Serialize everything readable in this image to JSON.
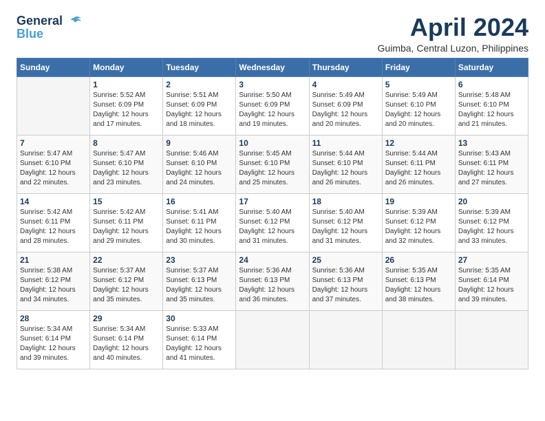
{
  "header": {
    "logo_line1": "General",
    "logo_line2": "Blue",
    "title": "April 2024",
    "subtitle": "Guimba, Central Luzon, Philippines"
  },
  "calendar": {
    "days_of_week": [
      "Sunday",
      "Monday",
      "Tuesday",
      "Wednesday",
      "Thursday",
      "Friday",
      "Saturday"
    ],
    "weeks": [
      [
        {
          "day": "",
          "info": ""
        },
        {
          "day": "1",
          "info": "Sunrise: 5:52 AM\nSunset: 6:09 PM\nDaylight: 12 hours\nand 17 minutes."
        },
        {
          "day": "2",
          "info": "Sunrise: 5:51 AM\nSunset: 6:09 PM\nDaylight: 12 hours\nand 18 minutes."
        },
        {
          "day": "3",
          "info": "Sunrise: 5:50 AM\nSunset: 6:09 PM\nDaylight: 12 hours\nand 19 minutes."
        },
        {
          "day": "4",
          "info": "Sunrise: 5:49 AM\nSunset: 6:09 PM\nDaylight: 12 hours\nand 20 minutes."
        },
        {
          "day": "5",
          "info": "Sunrise: 5:49 AM\nSunset: 6:10 PM\nDaylight: 12 hours\nand 20 minutes."
        },
        {
          "day": "6",
          "info": "Sunrise: 5:48 AM\nSunset: 6:10 PM\nDaylight: 12 hours\nand 21 minutes."
        }
      ],
      [
        {
          "day": "7",
          "info": "Sunrise: 5:47 AM\nSunset: 6:10 PM\nDaylight: 12 hours\nand 22 minutes."
        },
        {
          "day": "8",
          "info": "Sunrise: 5:47 AM\nSunset: 6:10 PM\nDaylight: 12 hours\nand 23 minutes."
        },
        {
          "day": "9",
          "info": "Sunrise: 5:46 AM\nSunset: 6:10 PM\nDaylight: 12 hours\nand 24 minutes."
        },
        {
          "day": "10",
          "info": "Sunrise: 5:45 AM\nSunset: 6:10 PM\nDaylight: 12 hours\nand 25 minutes."
        },
        {
          "day": "11",
          "info": "Sunrise: 5:44 AM\nSunset: 6:10 PM\nDaylight: 12 hours\nand 26 minutes."
        },
        {
          "day": "12",
          "info": "Sunrise: 5:44 AM\nSunset: 6:11 PM\nDaylight: 12 hours\nand 26 minutes."
        },
        {
          "day": "13",
          "info": "Sunrise: 5:43 AM\nSunset: 6:11 PM\nDaylight: 12 hours\nand 27 minutes."
        }
      ],
      [
        {
          "day": "14",
          "info": "Sunrise: 5:42 AM\nSunset: 6:11 PM\nDaylight: 12 hours\nand 28 minutes."
        },
        {
          "day": "15",
          "info": "Sunrise: 5:42 AM\nSunset: 6:11 PM\nDaylight: 12 hours\nand 29 minutes."
        },
        {
          "day": "16",
          "info": "Sunrise: 5:41 AM\nSunset: 6:11 PM\nDaylight: 12 hours\nand 30 minutes."
        },
        {
          "day": "17",
          "info": "Sunrise: 5:40 AM\nSunset: 6:12 PM\nDaylight: 12 hours\nand 31 minutes."
        },
        {
          "day": "18",
          "info": "Sunrise: 5:40 AM\nSunset: 6:12 PM\nDaylight: 12 hours\nand 31 minutes."
        },
        {
          "day": "19",
          "info": "Sunrise: 5:39 AM\nSunset: 6:12 PM\nDaylight: 12 hours\nand 32 minutes."
        },
        {
          "day": "20",
          "info": "Sunrise: 5:39 AM\nSunset: 6:12 PM\nDaylight: 12 hours\nand 33 minutes."
        }
      ],
      [
        {
          "day": "21",
          "info": "Sunrise: 5:38 AM\nSunset: 6:12 PM\nDaylight: 12 hours\nand 34 minutes."
        },
        {
          "day": "22",
          "info": "Sunrise: 5:37 AM\nSunset: 6:12 PM\nDaylight: 12 hours\nand 35 minutes."
        },
        {
          "day": "23",
          "info": "Sunrise: 5:37 AM\nSunset: 6:13 PM\nDaylight: 12 hours\nand 35 minutes."
        },
        {
          "day": "24",
          "info": "Sunrise: 5:36 AM\nSunset: 6:13 PM\nDaylight: 12 hours\nand 36 minutes."
        },
        {
          "day": "25",
          "info": "Sunrise: 5:36 AM\nSunset: 6:13 PM\nDaylight: 12 hours\nand 37 minutes."
        },
        {
          "day": "26",
          "info": "Sunrise: 5:35 AM\nSunset: 6:13 PM\nDaylight: 12 hours\nand 38 minutes."
        },
        {
          "day": "27",
          "info": "Sunrise: 5:35 AM\nSunset: 6:14 PM\nDaylight: 12 hours\nand 39 minutes."
        }
      ],
      [
        {
          "day": "28",
          "info": "Sunrise: 5:34 AM\nSunset: 6:14 PM\nDaylight: 12 hours\nand 39 minutes."
        },
        {
          "day": "29",
          "info": "Sunrise: 5:34 AM\nSunset: 6:14 PM\nDaylight: 12 hours\nand 40 minutes."
        },
        {
          "day": "30",
          "info": "Sunrise: 5:33 AM\nSunset: 6:14 PM\nDaylight: 12 hours\nand 41 minutes."
        },
        {
          "day": "",
          "info": ""
        },
        {
          "day": "",
          "info": ""
        },
        {
          "day": "",
          "info": ""
        },
        {
          "day": "",
          "info": ""
        }
      ]
    ]
  }
}
